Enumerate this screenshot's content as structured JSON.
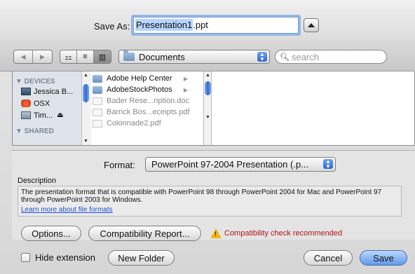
{
  "save_as": {
    "label": "Save As:",
    "filename_selected": "Presentation1",
    "filename_ext": ".ppt"
  },
  "toolbar": {
    "back_glyph": "◀",
    "forward_glyph": "▶",
    "view_icon_glyph": "⚏",
    "view_list_glyph": "≡",
    "view_column_glyph": "▥",
    "location": "Documents",
    "search_placeholder": "search"
  },
  "sidebar": {
    "devices_header": "▼ DEVICES",
    "shared_header": "▼ SHARED",
    "items": [
      {
        "label": "Jessica B...",
        "icon": "computer-icon"
      },
      {
        "label": "OSX",
        "icon": "hard-drive-icon"
      },
      {
        "label": "Tim...",
        "icon": "time-machine-icon",
        "eject": "⏏"
      }
    ]
  },
  "files": [
    {
      "name": "Adobe Help Center",
      "kind": "folder",
      "dim": false
    },
    {
      "name": "AdobeStockPhotos",
      "kind": "folder",
      "dim": false
    },
    {
      "name": "Bader Rese...ription.doc",
      "kind": "doc",
      "dim": true
    },
    {
      "name": "Barrick Bos...eceipts.pdf",
      "kind": "doc",
      "dim": true
    },
    {
      "name": "Colonnade2.pdf",
      "kind": "doc",
      "dim": true
    }
  ],
  "format": {
    "label": "Format:",
    "value": "PowerPoint 97-2004 Presentation (.p...",
    "description_title": "Description",
    "description": "The presentation format that is compatible with PowerPoint 98 through PowerPoint 2004 for Mac and PowerPoint 97 through PowerPoint 2003 for Windows.",
    "learn_more": "Learn more about file formats"
  },
  "buttons": {
    "options": "Options...",
    "compat_report": "Compatibility Report...",
    "compat_warning": "Compatibility check recommended",
    "hide_extension": "Hide extension",
    "new_folder": "New Folder",
    "cancel": "Cancel",
    "save": "Save"
  },
  "colors": {
    "accent": "#5e9ae8",
    "warning_text": "#b2121b",
    "link": "#1a4fd1"
  }
}
